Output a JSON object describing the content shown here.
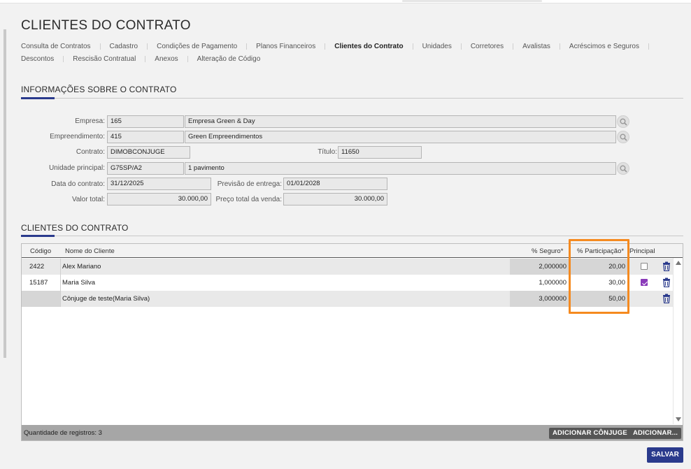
{
  "page": {
    "title": "CLIENTES DO CONTRATO"
  },
  "tabs": {
    "row1": [
      "Consulta de Contratos",
      "Cadastro",
      "Condições de Pagamento",
      "Planos Financeiros",
      "Clientes do Contrato",
      "Unidades",
      "Corretores",
      "Avalistas",
      "Acréscimos e Seguros"
    ],
    "row2": [
      "Descontos",
      "Rescisão Contratual",
      "Anexos",
      "Alteração de Código"
    ],
    "active": "Clientes do Contrato"
  },
  "contract_info": {
    "section_title": "INFORMAÇÕES SOBRE O CONTRATO",
    "empresa_label": "Empresa:",
    "empresa_code": "165",
    "empresa_name": "Empresa Green & Day",
    "empreendimento_label": "Empreendimento:",
    "empreendimento_code": "415",
    "empreendimento_name": "Green Empreendimentos",
    "contrato_label": "Contrato:",
    "contrato_value": "DIMOBCONJUGE",
    "titulo_label": "Título:",
    "titulo_value": "11650",
    "unidade_label": "Unidade principal:",
    "unidade_code": "G75SP/A2",
    "unidade_name": "1 pavimento",
    "data_label": "Data do contrato:",
    "data_value": "31/12/2025",
    "previsao_label": "Previsão de entrega:",
    "previsao_value": "01/01/2028",
    "valor_label": "Valor total:",
    "valor_value": "30.000,00",
    "preco_label": "Preço total da venda:",
    "preco_value": "30.000,00"
  },
  "clients": {
    "section_title": "CLIENTES DO CONTRATO",
    "headers": {
      "codigo": "Código",
      "nome": "Nome do Cliente",
      "seguro": "% Seguro*",
      "participacao": "% Participação*",
      "principal": "Principal"
    },
    "rows": [
      {
        "codigo": "2422",
        "nome": "Alex Mariano",
        "seguro": "2,000000",
        "participacao": "20,00",
        "principal": false
      },
      {
        "codigo": "15187",
        "nome": "Maria Silva",
        "seguro": "1,000000",
        "participacao": "30,00",
        "principal": true
      },
      {
        "codigo": "",
        "nome": "Cônjuge de teste(Maria Silva)",
        "seguro": "3,000000",
        "participacao": "50,00",
        "principal": null
      }
    ],
    "count_label": "Quantidade de registros: 3",
    "add_spouse_label": "ADICIONAR CÔNJUGE",
    "add_label": "ADICIONAR..."
  },
  "save_label": "SALVAR",
  "colors": {
    "accent": "#2a3a8c",
    "highlight": "#f58a1f",
    "checkbox_on": "#8a3ab9"
  }
}
